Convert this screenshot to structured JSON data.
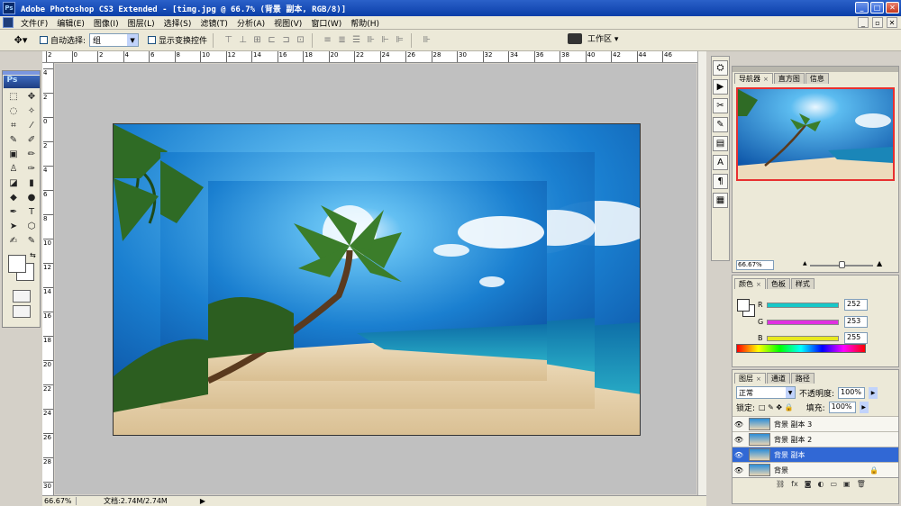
{
  "window": {
    "title": "Adobe Photoshop CS3 Extended - [timg.jpg @ 66.7% (背景 副本, RGB/8)]",
    "logo": "Ps",
    "minimize": "_",
    "maximize": "□",
    "close": "✕"
  },
  "menu": {
    "items": [
      "文件(F)",
      "编辑(E)",
      "图像(I)",
      "图层(L)",
      "选择(S)",
      "滤镜(T)",
      "分析(A)",
      "视图(V)",
      "窗口(W)",
      "帮助(H)"
    ],
    "doc_minimize": "_",
    "doc_restore": "▫",
    "doc_close": "✕"
  },
  "options": {
    "tool_icon": "move-tool-icon",
    "auto_select_label": "自动选择:",
    "auto_select_value": "组",
    "show_transform_label": "显示变换控件",
    "workspace_label": "工作区 ▾",
    "align_icons_a": [
      "⊤",
      "⊥",
      "⊞",
      "⊏",
      "⊐",
      "⊡"
    ],
    "align_icons_b": [
      "≡",
      "≣",
      "☰",
      "⊪",
      "⊩",
      "⊫"
    ],
    "auto_align_icon": "⊪"
  },
  "toolbox": {
    "badge": "Ps",
    "tools": [
      "⬚",
      "✥",
      "◌",
      "✧",
      "⌗",
      "⁄",
      "✎",
      "✐",
      "▣",
      "✏",
      "♙",
      "✑",
      "◪",
      "▮",
      "◆",
      "●",
      "✒",
      "T",
      "➤",
      "⬡",
      "✍",
      "✎",
      "✋",
      "⚲"
    ],
    "swap_icon": "⇆"
  },
  "rulers": {
    "top": [
      "2",
      "0",
      "2",
      "4",
      "6",
      "8",
      "10",
      "12",
      "14",
      "16",
      "18",
      "20",
      "22",
      "24",
      "26",
      "28",
      "30",
      "32",
      "34",
      "36",
      "38",
      "40",
      "42",
      "44",
      "46"
    ],
    "left": [
      "4",
      "2",
      "0",
      "2",
      "4",
      "6",
      "8",
      "10",
      "12",
      "14",
      "16",
      "18",
      "20",
      "22",
      "24",
      "26",
      "28",
      "30"
    ]
  },
  "status": {
    "zoom": "66.67%",
    "doc_info": "文档:2.74M/2.74M",
    "play_icon": "▶"
  },
  "navigator": {
    "tabs": [
      "导航器",
      "直方图",
      "信息"
    ],
    "zoom": "66.67%",
    "zoom_out_icon": "▲",
    "zoom_in_icon": "▲"
  },
  "color_panel": {
    "tabs": [
      "颜色",
      "色板",
      "样式"
    ],
    "r_label": "R",
    "g_label": "G",
    "b_label": "B",
    "r_value": "252",
    "g_value": "253",
    "b_value": "255",
    "colors": {
      "r_bar": "#18c8c8",
      "g_bar": "#e030e0",
      "b_bar": "#e8e820"
    }
  },
  "layers_panel": {
    "tabs": [
      "图层",
      "通道",
      "路径"
    ],
    "blend_mode": "正常",
    "opacity_label": "不透明度:",
    "opacity_value": "100%",
    "lock_label": "锁定:",
    "lock_icons": "□ ✎ ✥ 🔒",
    "fill_label": "填充:",
    "fill_value": "100%",
    "layers": [
      {
        "name": "背景 副本 3",
        "visible": true,
        "selected": false
      },
      {
        "name": "背景 副本 2",
        "visible": true,
        "selected": false
      },
      {
        "name": "背景 副本",
        "visible": true,
        "selected": true
      },
      {
        "name": "背景",
        "visible": true,
        "selected": false
      }
    ],
    "footer_icons": [
      "⛓",
      "fx",
      "◙",
      "◐",
      "▭",
      "▣",
      "🗑"
    ]
  },
  "dock": {
    "icons": [
      "⛭",
      "▶",
      "✂",
      "✎",
      "▤",
      "A",
      "¶",
      "▦"
    ]
  }
}
